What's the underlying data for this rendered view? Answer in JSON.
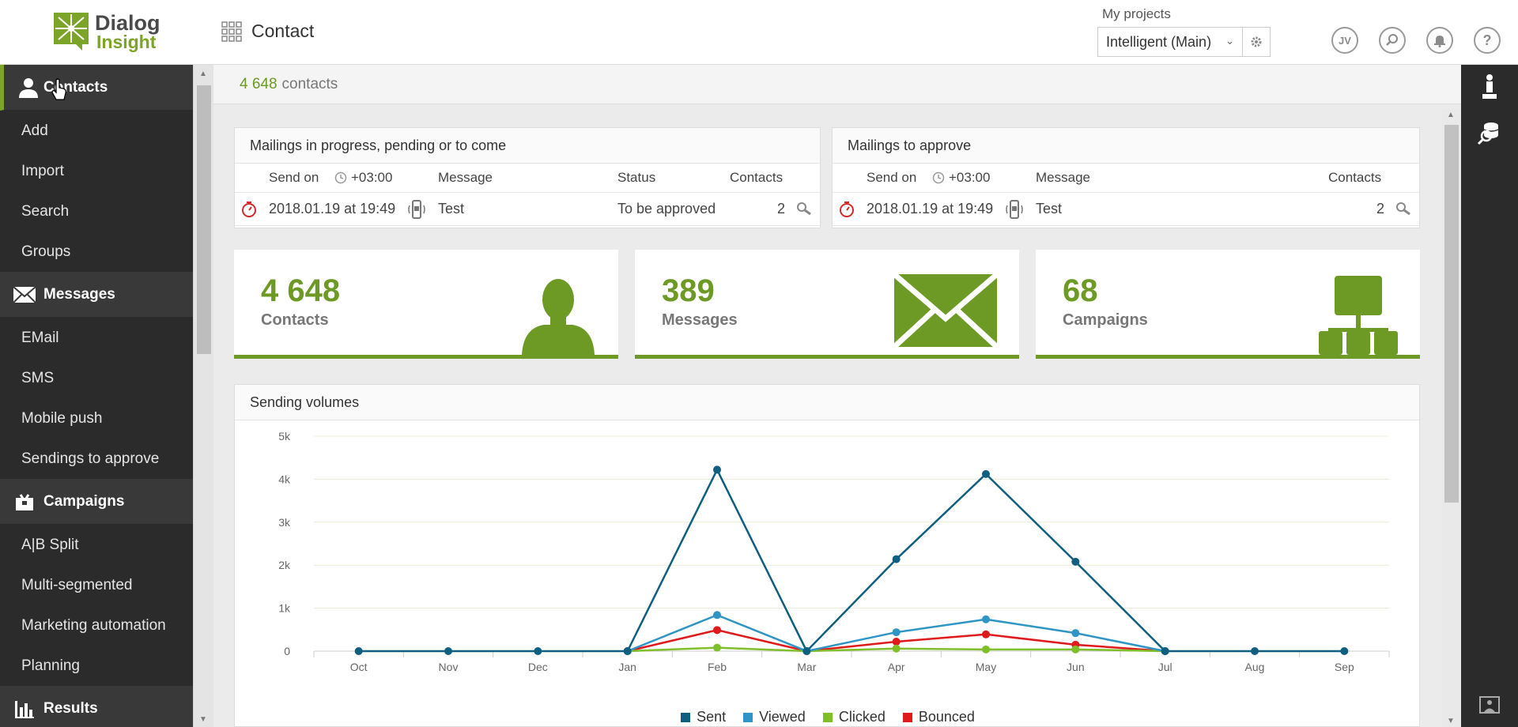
{
  "header": {
    "logo_line1": "Dialog",
    "logo_line2": "Insight",
    "title": "Contact",
    "projects_label": "My projects",
    "project_selected": "Intelligent (Main)",
    "user_initials": "JV"
  },
  "sidebar": {
    "sections": [
      {
        "label": "Contacts",
        "icon": "person-icon",
        "items": [
          "Add",
          "Import",
          "Search",
          "Groups"
        ]
      },
      {
        "label": "Messages",
        "icon": "envelope-icon",
        "items": [
          "EMail",
          "SMS",
          "Mobile push",
          "Sendings to approve"
        ]
      },
      {
        "label": "Campaigns",
        "icon": "campaign-icon",
        "items": [
          "A|B Split",
          "Multi-segmented",
          "Marketing automation",
          "Planning"
        ]
      },
      {
        "label": "Results",
        "icon": "bar-chart-icon",
        "items": []
      }
    ]
  },
  "main": {
    "contacts_count": "4 648",
    "contacts_count_label": "contacts",
    "mailings_progress": {
      "title": "Mailings in progress, pending or to come",
      "headers": {
        "send_on": "Send on",
        "timezone": "+03:00",
        "message": "Message",
        "status": "Status",
        "contacts": "Contacts"
      },
      "rows": [
        {
          "date": "2018.01.19 at 19:49",
          "message": "Test",
          "status": "To be approved",
          "contacts": "2"
        }
      ]
    },
    "mailings_approve": {
      "title": "Mailings to approve",
      "headers": {
        "send_on": "Send on",
        "timezone": "+03:00",
        "message": "Message",
        "contacts": "Contacts"
      },
      "rows": [
        {
          "date": "2018.01.19 at 19:49",
          "message": "Test",
          "contacts": "2"
        }
      ]
    },
    "stats": [
      {
        "value": "4 648",
        "label": "Contacts"
      },
      {
        "value": "389",
        "label": "Messages"
      },
      {
        "value": "68",
        "label": "Campaigns"
      }
    ],
    "chart_title": "Sending volumes"
  },
  "colors": {
    "brand_green": "#6c9a24",
    "sent": "#0e5f80",
    "viewed": "#2e95c6",
    "clicked": "#7fbf2a",
    "bounced": "#e01a1a"
  },
  "chart_data": {
    "type": "line",
    "title": "Sending volumes",
    "x": [
      "Oct",
      "Nov",
      "Dec",
      "Jan",
      "Feb",
      "Mar",
      "Apr",
      "May",
      "Jun",
      "Jul",
      "Aug",
      "Sep"
    ],
    "y_ticks": [
      "0",
      "1k",
      "2k",
      "3k",
      "4k",
      "5k"
    ],
    "ylim": [
      0,
      5000
    ],
    "grid": true,
    "legend_position": "bottom",
    "series": [
      {
        "name": "Sent",
        "values": [
          0,
          0,
          0,
          0,
          4220,
          0,
          2140,
          4120,
          2080,
          0,
          0,
          0
        ]
      },
      {
        "name": "Viewed",
        "values": [
          null,
          null,
          null,
          0,
          840,
          0,
          440,
          740,
          420,
          0,
          null,
          null
        ]
      },
      {
        "name": "Clicked",
        "values": [
          null,
          null,
          null,
          0,
          80,
          0,
          60,
          40,
          40,
          0,
          null,
          null
        ]
      },
      {
        "name": "Bounced",
        "values": [
          null,
          null,
          null,
          0,
          490,
          0,
          220,
          390,
          150,
          0,
          null,
          null
        ]
      }
    ]
  }
}
